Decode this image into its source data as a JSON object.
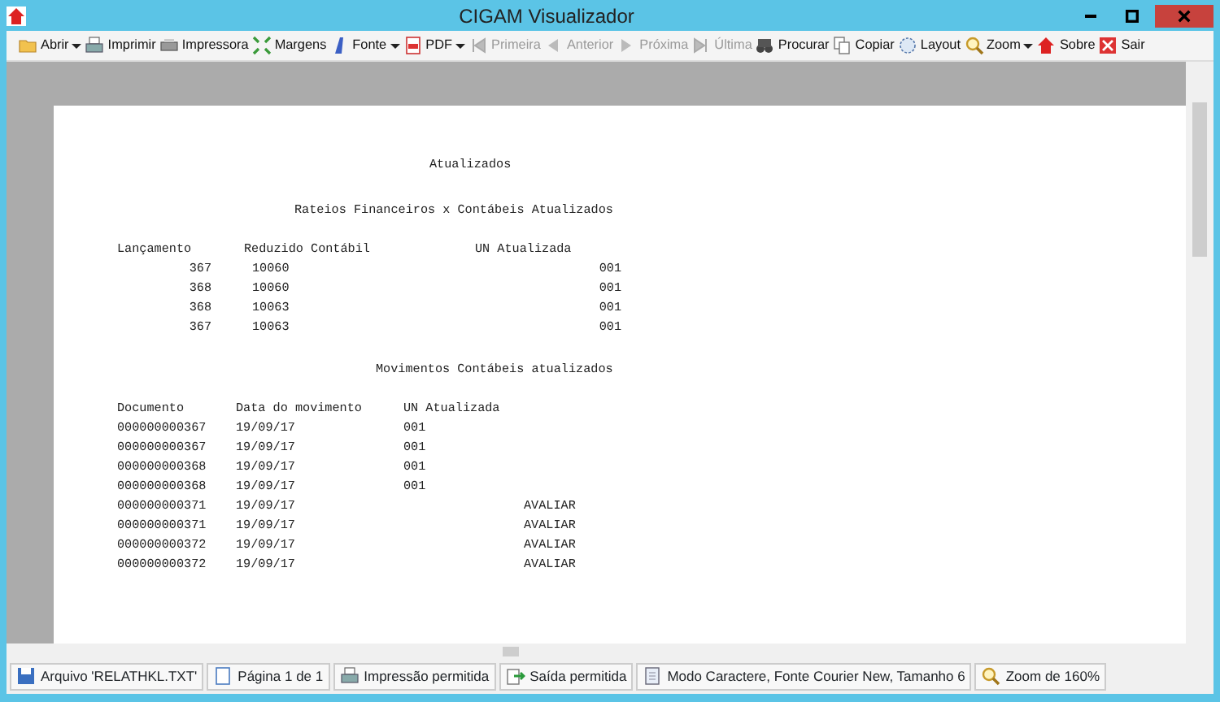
{
  "window": {
    "title": "CIGAM Visualizador"
  },
  "toolbar": [
    {
      "label": "Abrir",
      "dropdown": true,
      "disabled": false
    },
    {
      "label": "Imprimir",
      "dropdown": false,
      "disabled": false
    },
    {
      "label": "Impressora",
      "dropdown": false,
      "disabled": false
    },
    {
      "label": "Margens",
      "dropdown": false,
      "disabled": false
    },
    {
      "label": "Fonte",
      "dropdown": true,
      "disabled": false
    },
    {
      "label": "PDF",
      "dropdown": true,
      "disabled": false
    },
    {
      "label": "Primeira",
      "dropdown": false,
      "disabled": true
    },
    {
      "label": "Anterior",
      "dropdown": false,
      "disabled": true
    },
    {
      "label": "Próxima",
      "dropdown": false,
      "disabled": true
    },
    {
      "label": "Última",
      "dropdown": false,
      "disabled": true
    },
    {
      "label": "Procurar",
      "dropdown": false,
      "disabled": false
    },
    {
      "label": "Copiar",
      "dropdown": false,
      "disabled": false
    },
    {
      "label": "Layout",
      "dropdown": false,
      "disabled": false
    },
    {
      "label": "Zoom",
      "dropdown": true,
      "disabled": false
    },
    {
      "label": "Sobre",
      "dropdown": false,
      "disabled": false
    },
    {
      "label": "Sair",
      "dropdown": false,
      "disabled": false
    }
  ],
  "report": {
    "title": "Atualizados",
    "sections": [
      {
        "title": "Rateios Financeiros x Contábeis Atualizados",
        "columns": [
          "Lançamento",
          "Reduzido Contábil",
          "UN Atualizada"
        ],
        "rows": [
          [
            "367",
            "10060",
            "001"
          ],
          [
            "368",
            "10060",
            "001"
          ],
          [
            "368",
            "10063",
            "001"
          ],
          [
            "367",
            "10063",
            "001"
          ]
        ]
      },
      {
        "title": "Movimentos Contábeis atualizados",
        "columns": [
          "Documento",
          "Data do movimento",
          "UN Atualizada"
        ],
        "rows": [
          {
            "documento": "000000000367",
            "data": "19/09/17",
            "un_atualizada": "001"
          },
          {
            "documento": "000000000367",
            "data": "19/09/17",
            "un_atualizada": "001"
          },
          {
            "documento": "000000000368",
            "data": "19/09/17",
            "un_atualizada": "001"
          },
          {
            "documento": "000000000368",
            "data": "19/09/17",
            "un_atualizada": "001"
          },
          {
            "documento": "000000000371",
            "data": "19/09/17",
            "column_4": "AVALIAR"
          },
          {
            "documento": "000000000371",
            "data": "19/09/17",
            "column_4": "AVALIAR"
          },
          {
            "documento": "000000000372",
            "data": "19/09/17",
            "column_4": "AVALIAR"
          },
          {
            "documento": "000000000372",
            "data": "19/09/17",
            "column_4": "AVALIAR"
          }
        ]
      }
    ]
  },
  "status_bar": [
    "Arquivo 'RELATHKL.TXT'",
    "Página 1 de 1",
    "Impressão permitida",
    "Saída permitida",
    "Modo Caractere, Fonte Courier New, Tamanho 6",
    "Zoom de 160%"
  ]
}
